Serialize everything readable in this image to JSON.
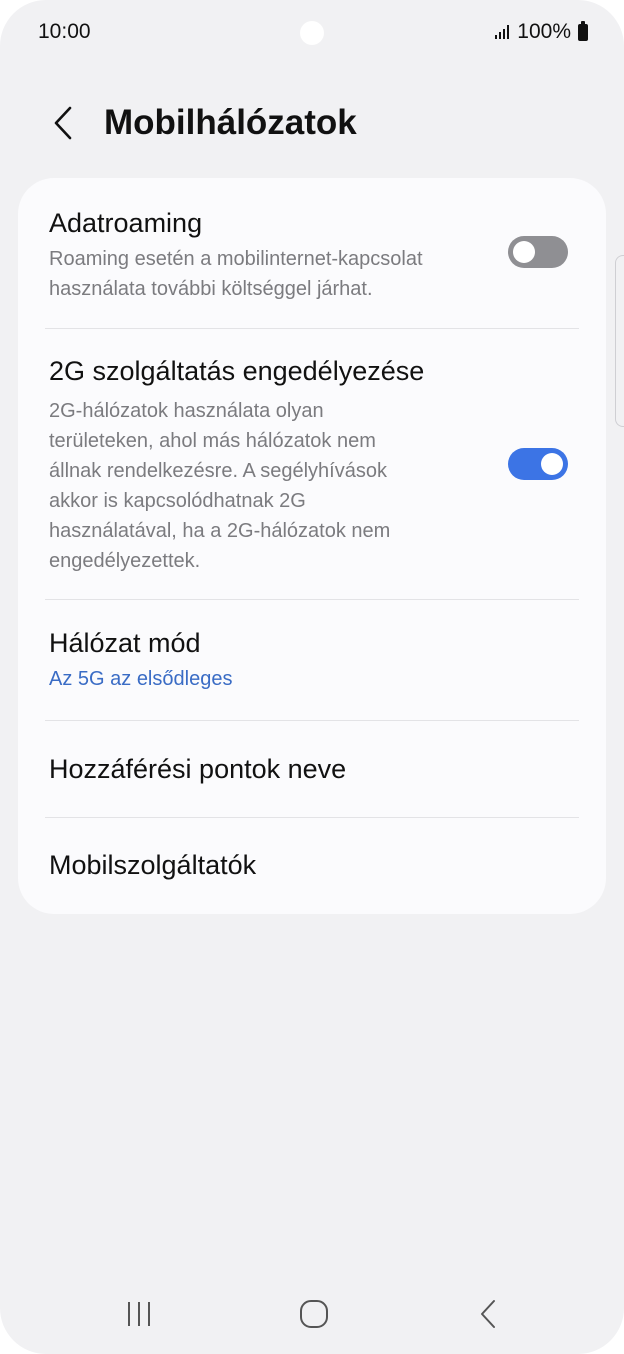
{
  "status_bar": {
    "time": "10:00",
    "battery_text": "100%",
    "icons": [
      "signal-icon",
      "battery-icon"
    ]
  },
  "header": {
    "back_icon": "chevron-left-icon",
    "title": "Mobilhálózatok"
  },
  "settings": {
    "data_roaming": {
      "title": "Adatroaming",
      "line1": "Roaming esetén a mobilinternet-kapcsolat",
      "line2": "használata további költséggel járhat.",
      "enabled": false
    },
    "allow_2g": {
      "title": "2G szolgáltatás engedélyezése",
      "lines": [
        "2G-hálózatok használata olyan",
        "területeken, ahol más hálózatok nem",
        "állnak rendelkezésre. A segélyhívások",
        "akkor is kapcsolódhatnak 2G",
        "használatával, ha a 2G-hálózatok nem",
        "engedélyezettek."
      ],
      "enabled": true
    },
    "network_mode": {
      "title": "Hálózat mód",
      "value": "Az 5G az elsődleges"
    },
    "access_point_names": {
      "title": "Hozzáférési pontok neve"
    },
    "network_operators": {
      "title": "Mobilszolgáltatók"
    }
  },
  "colors": {
    "accent": "#3c74e5",
    "link_text": "#3a6cc5",
    "toggle_off": "#8f8f93",
    "background": "#f1f1f3",
    "card": "#fbfbfd"
  },
  "nav_bar": {
    "icons": [
      "recent-apps-icon",
      "home-icon",
      "back-icon"
    ]
  }
}
